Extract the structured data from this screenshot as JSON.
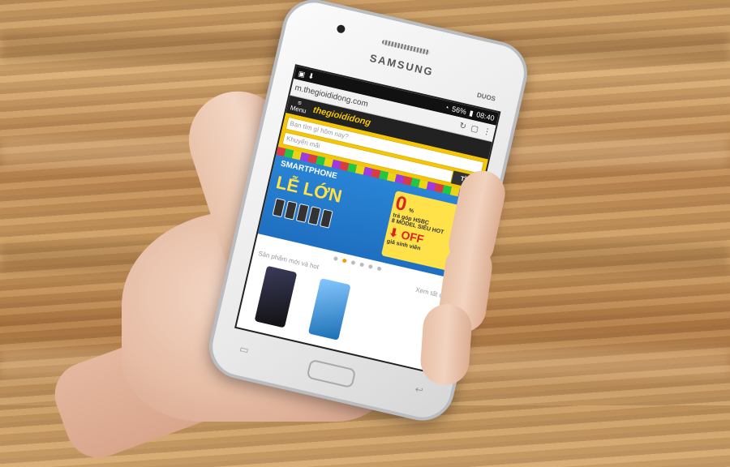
{
  "phone": {
    "brand": "SAMSUNG",
    "model_tag": "DUOS",
    "status_bar": {
      "signal": "56%",
      "time": "08:40"
    },
    "browser": {
      "url": "m.thegioididong.com",
      "menu_label": "Menu",
      "site_name": "thegioididong",
      "search_placeholder": "Bạn tìm gì hôm nay?",
      "search_secondary": "Khuyến mãi",
      "search_button": "TÌM"
    },
    "banner": {
      "title": "SMARTPHONE",
      "headline": "LỄ LỚN",
      "promo_rate": "0",
      "promo_unit": "%",
      "promo_line1": "trả góp HSBC",
      "promo_line2": "8 MODEL SIÊU HOT",
      "off_text": "OFF",
      "off_sub": "giá sinh viên"
    },
    "section": {
      "title": "Sản phẩm mới và hot",
      "link": "Xem tất cả »"
    }
  },
  "colors": {
    "accent_yellow": "#f7c600",
    "banner_blue": "#1f6fc0",
    "status_black": "#111111"
  }
}
